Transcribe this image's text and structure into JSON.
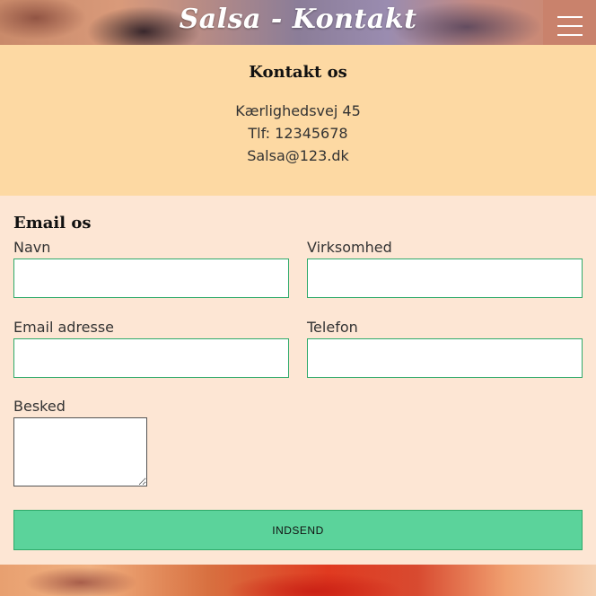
{
  "header": {
    "title": "Salsa - Kontakt",
    "menu_icon": "hamburger-menu-icon"
  },
  "contact": {
    "heading": "Kontakt os",
    "address": "Kærlighedsvej 45",
    "phone": "Tlf: 12345678",
    "email": "Salsa@123.dk"
  },
  "form": {
    "heading": "Email os",
    "fields": {
      "name": {
        "label": "Navn",
        "value": ""
      },
      "company": {
        "label": "Virksomhed",
        "value": ""
      },
      "email": {
        "label": "Email adresse",
        "value": ""
      },
      "phone": {
        "label": "Telefon",
        "value": ""
      },
      "message": {
        "label": "Besked",
        "value": ""
      }
    },
    "submit_label": "INDSEND"
  },
  "colors": {
    "contact_bg": "#fdd9a3",
    "form_bg": "#fde6d4",
    "submit_bg": "#5bd39b",
    "input_border": "#2eaa6a",
    "menu_bg": "#c9826c"
  }
}
